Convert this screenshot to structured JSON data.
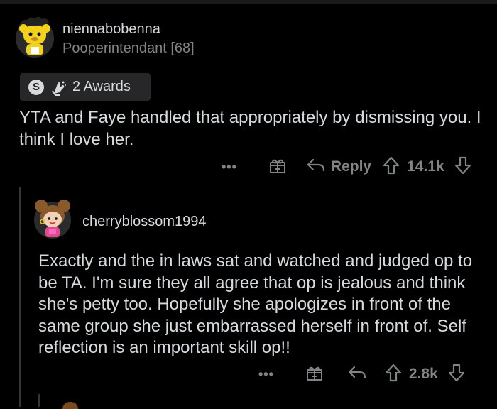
{
  "comment": {
    "username": "niennabobenna",
    "flair": "Pooperintendant [68]",
    "awards_label": "2 Awards",
    "award_badge_letter": "S",
    "body": "YTA and Faye handled that appropriately by dismissing you. I think I love her.",
    "actions": {
      "more": "•••",
      "reply_label": "Reply",
      "vote_count": "14.1k"
    }
  },
  "reply": {
    "username": "cherryblossom1994",
    "body": "Exactly and the in laws sat and watched and judged op to be TA. I'm sure they all agree that op is jealous and think she's petty too. Hopefully she apologizes in front of the same group she just embarrassed herself in front of. Self reflection is an important skill op!!",
    "actions": {
      "more": "•••",
      "vote_count": "2.8k"
    }
  },
  "colors": {
    "background": "#000000",
    "text": "#d7dadc",
    "muted": "#818384",
    "award_bg": "#272729",
    "thread_line": "#343536"
  },
  "icons": [
    "avatar-bear-icon",
    "silver-award-icon",
    "praying-hands-icon",
    "gift-icon",
    "reply-arrow-icon",
    "upvote-icon",
    "downvote-icon",
    "avatar-girl-icon"
  ]
}
